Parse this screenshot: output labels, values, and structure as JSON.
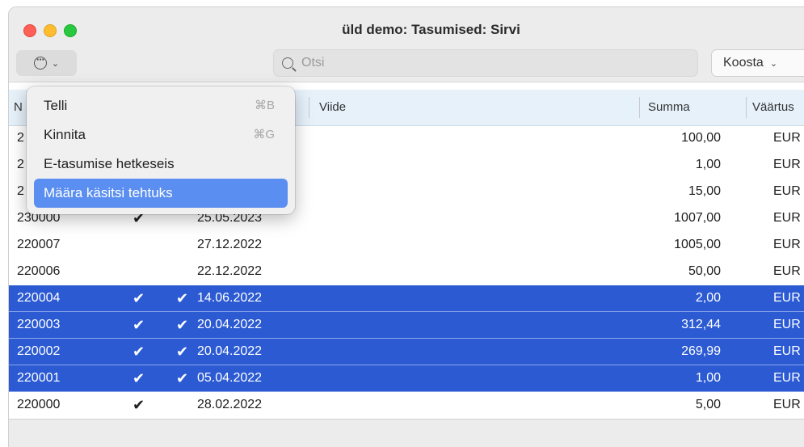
{
  "window": {
    "title": "üld demo: Tasumised: Sirvi"
  },
  "toolbar": {
    "action_icon": "ellipsis-circle-icon",
    "search_placeholder": "Otsi",
    "search_value": "",
    "koosta_label": "Koosta",
    "chevron": "⌄"
  },
  "columns": {
    "nr": "N",
    "viide": "Viide",
    "summa": "Summa",
    "vaartus": "Väärtus"
  },
  "menu": {
    "items": [
      {
        "label": "Telli",
        "shortcut": "⌘B"
      },
      {
        "label": "Kinnita",
        "shortcut": "⌘G"
      },
      {
        "label": "E-tasumise hetkeseis",
        "shortcut": ""
      },
      {
        "label": "Määra käsitsi tehtuks",
        "shortcut": ""
      }
    ]
  },
  "rows": [
    {
      "nr": "2",
      "c1": "",
      "c2": "",
      "date": "",
      "summa": "100,00",
      "valuuta": "EUR",
      "selected": false
    },
    {
      "nr": "2",
      "c1": "",
      "c2": "",
      "date": "",
      "summa": "1,00",
      "valuuta": "EUR",
      "selected": false
    },
    {
      "nr": "2",
      "c1": "",
      "c2": "",
      "date": "",
      "summa": "15,00",
      "valuuta": "EUR",
      "selected": false
    },
    {
      "nr": "230000",
      "c1": "✔",
      "c2": "",
      "date": "25.05.2023",
      "summa": "1007,00",
      "valuuta": "EUR",
      "selected": false
    },
    {
      "nr": "220007",
      "c1": "",
      "c2": "",
      "date": "27.12.2022",
      "summa": "1005,00",
      "valuuta": "EUR",
      "selected": false
    },
    {
      "nr": "220006",
      "c1": "",
      "c2": "",
      "date": "22.12.2022",
      "summa": "50,00",
      "valuuta": "EUR",
      "selected": false
    },
    {
      "nr": "220004",
      "c1": "✔",
      "c2": "✔",
      "date": "14.06.2022",
      "summa": "2,00",
      "valuuta": "EUR",
      "selected": true
    },
    {
      "nr": "220003",
      "c1": "✔",
      "c2": "✔",
      "date": "20.04.2022",
      "summa": "312,44",
      "valuuta": "EUR",
      "selected": true
    },
    {
      "nr": "220002",
      "c1": "✔",
      "c2": "✔",
      "date": "20.04.2022",
      "summa": "269,99",
      "valuuta": "EUR",
      "selected": true
    },
    {
      "nr": "220001",
      "c1": "✔",
      "c2": "✔",
      "date": "05.04.2022",
      "summa": "1,00",
      "valuuta": "EUR",
      "selected": true
    },
    {
      "nr": "220000",
      "c1": "✔",
      "c2": "",
      "date": "28.02.2022",
      "summa": "5,00",
      "valuuta": "EUR",
      "selected": false
    }
  ],
  "colors": {
    "selection": "#2b5ad3",
    "menu_highlight": "#5a8ef0",
    "header": "#e6f1fa"
  }
}
